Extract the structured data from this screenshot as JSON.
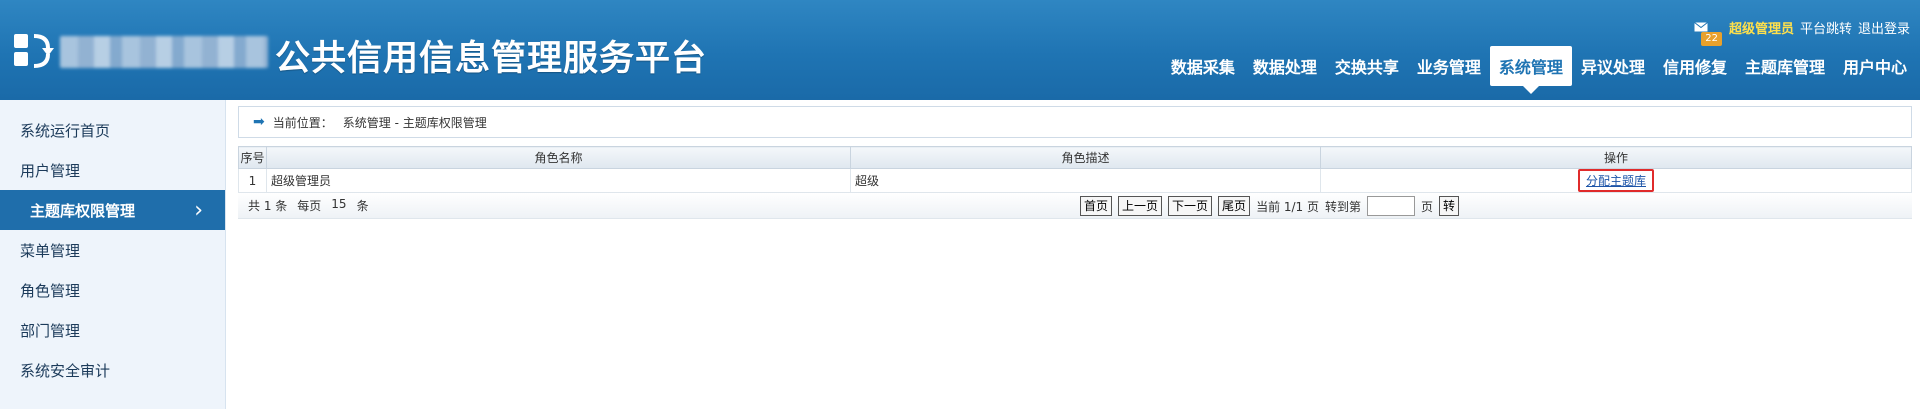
{
  "header": {
    "site_title": "公共信用信息管理服务平台",
    "mail_count": "22",
    "user_name": "超级管理员",
    "switch_platform": "平台跳转",
    "logout": "退出登录"
  },
  "nav": [
    {
      "label": "数据采集"
    },
    {
      "label": "数据处理"
    },
    {
      "label": "交换共享"
    },
    {
      "label": "业务管理"
    },
    {
      "label": "系统管理",
      "active": true
    },
    {
      "label": "异议处理"
    },
    {
      "label": "信用修复"
    },
    {
      "label": "主题库管理"
    },
    {
      "label": "用户中心"
    }
  ],
  "sidebar": {
    "items": [
      {
        "label": "系统运行首页"
      },
      {
        "label": "用户管理"
      },
      {
        "label": "主题库权限管理",
        "active": true
      },
      {
        "label": "菜单管理"
      },
      {
        "label": "角色管理"
      },
      {
        "label": "部门管理"
      },
      {
        "label": "系统安全审计"
      }
    ]
  },
  "breadcrumb": {
    "label": "当前位置：",
    "path": "系统管理 - 主题库权限管理"
  },
  "table": {
    "headers": [
      "序号",
      "角色名称",
      "角色描述",
      "操作"
    ],
    "rows": [
      {
        "seq": "1",
        "name": "超级管理员",
        "desc": "超级",
        "op": "分配主题库"
      }
    ]
  },
  "pager": {
    "total": "共 1 条",
    "per_page": "每页",
    "per_page_value": "15",
    "per_page_unit": "条",
    "first": "首页",
    "prev": "上一页",
    "next": "下一页",
    "last": "尾页",
    "current": "当前 1/1 页",
    "goto": "转到第",
    "page_unit": "页",
    "go": "转"
  },
  "colors": {
    "header_blue": "#1f74b3",
    "sidebar_active": "#1f6eab",
    "highlight_red": "#e02b2b",
    "user_name_yellow": "#ffe04b"
  }
}
